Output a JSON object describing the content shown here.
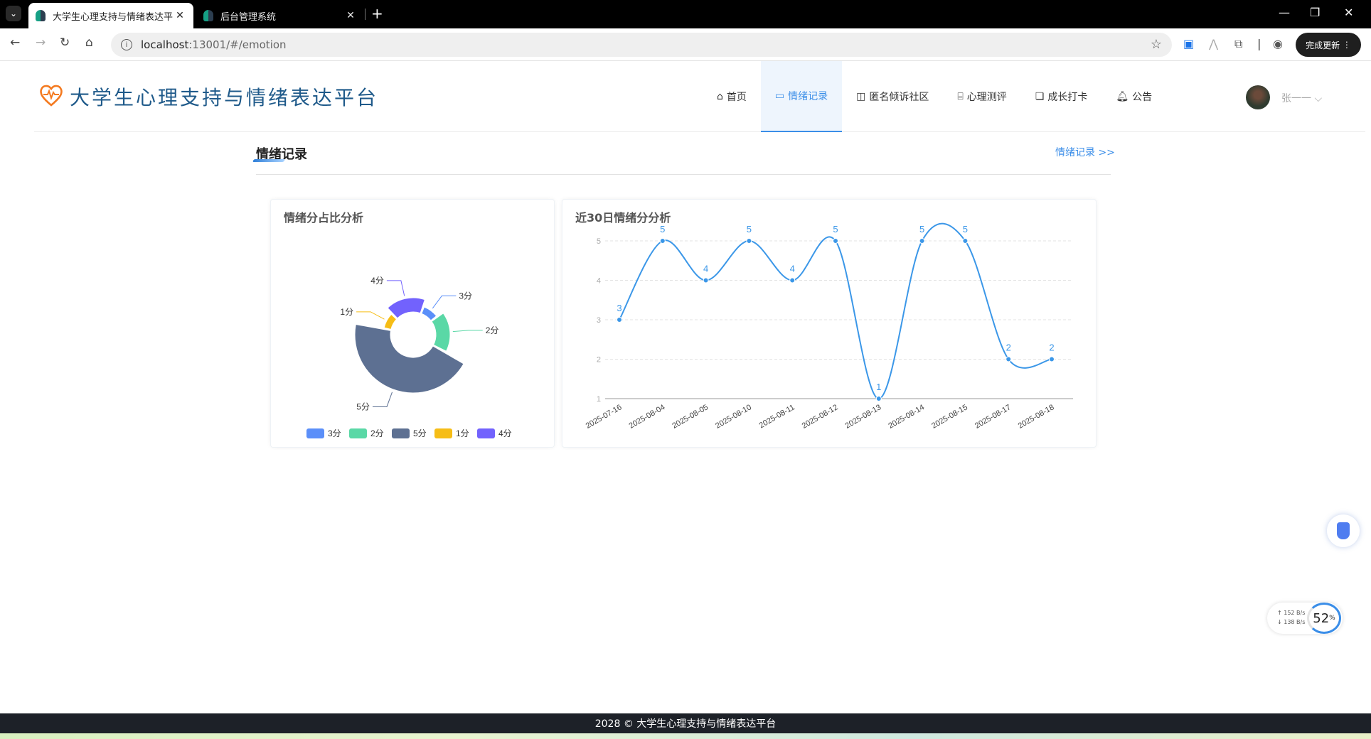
{
  "browser": {
    "tabs": [
      {
        "title": "大学生心理支持与情绪表达平台",
        "close": "✕"
      },
      {
        "title": "后台管理系统",
        "close": "✕"
      }
    ],
    "new_tab": "+",
    "url_host": "localhost",
    "url_rest": ":13001/#/emotion",
    "update_label": "完成更新",
    "update_menu": "⋮"
  },
  "site": {
    "title": "大学生心理支持与情绪表达平台",
    "nav": [
      {
        "label": "首页",
        "icon": "home-icon"
      },
      {
        "label": "情绪记录",
        "icon": "emotion-record-icon"
      },
      {
        "label": "匿名倾诉社区",
        "icon": "book-icon"
      },
      {
        "label": "心理测评",
        "icon": "assessment-icon"
      },
      {
        "label": "成长打卡",
        "icon": "checkin-icon"
      },
      {
        "label": "公告",
        "icon": "bell-icon"
      }
    ],
    "user_name": "张一一",
    "user_caret": "⌵"
  },
  "section": {
    "title": "情绪记录",
    "more_link": "情绪记录 >>"
  },
  "pie_card": {
    "title": "情绪分占比分析"
  },
  "line_card": {
    "title": "近30日情绪分分析"
  },
  "chart_data": [
    {
      "type": "pie",
      "title": "情绪分占比分析",
      "donut": true,
      "rose": true,
      "slices": [
        {
          "label": "3分",
          "value": 1,
          "color": "#5b8ff9"
        },
        {
          "label": "2分",
          "value": 2,
          "color": "#5ad8a6"
        },
        {
          "label": "5分",
          "value": 5,
          "color": "#5d7092"
        },
        {
          "label": "1分",
          "value": 1,
          "color": "#f6bd16"
        },
        {
          "label": "4分",
          "value": 2,
          "color": "#7262fd"
        }
      ],
      "legend": [
        "3分",
        "2分",
        "5分",
        "1分",
        "4分"
      ],
      "legend_position": "bottom"
    },
    {
      "type": "line",
      "title": "近30日情绪分分析",
      "smooth": true,
      "x": [
        "2025-07-16",
        "2025-08-04",
        "2025-08-05",
        "2025-08-10",
        "2025-08-11",
        "2025-08-12",
        "2025-08-13",
        "2025-08-14",
        "2025-08-15",
        "2025-08-17",
        "2025-08-18"
      ],
      "values": [
        3,
        5,
        4,
        5,
        4,
        5,
        1,
        5,
        5,
        2,
        2
      ],
      "ylim": [
        1,
        5
      ],
      "yticks": [
        1,
        2,
        3,
        4,
        5
      ],
      "grid": true,
      "color": "#3b97e8"
    }
  ],
  "footer": {
    "text": "2028 © 大学生心理支持与情绪表达平台"
  },
  "widgets": {
    "upload_rate": "↑ 152 B/s",
    "download_rate": "↓ 138 B/s",
    "percent": "52",
    "percent_unit": "%"
  }
}
